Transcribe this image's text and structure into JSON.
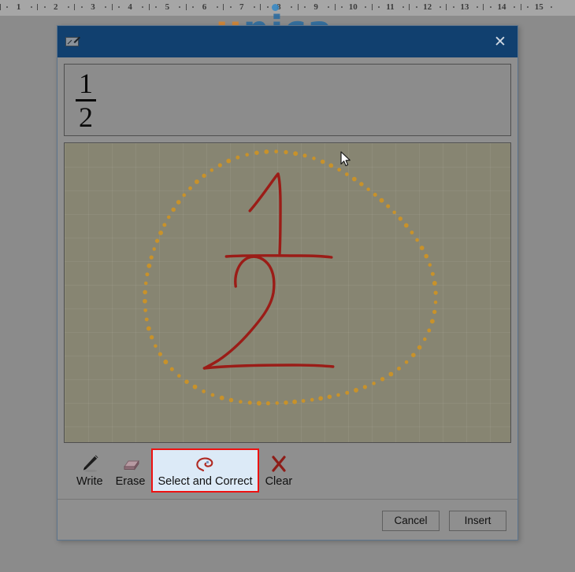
{
  "ruler": {
    "name": "word-horizontal-ruler",
    "marks": [
      "1",
      "2",
      "3",
      "4",
      "5",
      "6",
      "7",
      "8",
      "9",
      "10",
      "11",
      "12",
      "13",
      "14",
      "15"
    ]
  },
  "watermark": {
    "first_letter": "u",
    "rest": "nica",
    "color_u": "#d6842c",
    "color_rest": "#2468a0"
  },
  "dialog": {
    "titlebar": {
      "icon": "ink-equation-icon",
      "title": "",
      "close_label": "✕",
      "background": "#11406f"
    },
    "preview": {
      "name": "equation-preview",
      "numerator": "1",
      "denominator": "2",
      "expression": "1/2"
    },
    "canvas": {
      "name": "ink-writing-canvas",
      "background": "#878572",
      "ink_color": "#9b1c17",
      "lasso_color": "#c8922a",
      "grid": true,
      "strokes": [
        "handwritten-1",
        "fraction-bar",
        "handwritten-2"
      ],
      "selection": "dotted-lasso-loop"
    },
    "tools": [
      {
        "id": "write",
        "label": "Write",
        "icon": "pen-icon",
        "active": false
      },
      {
        "id": "erase",
        "label": "Erase",
        "icon": "eraser-icon",
        "active": false
      },
      {
        "id": "select",
        "label": "Select and Correct",
        "icon": "lasso-icon",
        "active": true
      },
      {
        "id": "clear",
        "label": "Clear",
        "icon": "x-mark-icon",
        "active": false
      }
    ],
    "footer": {
      "cancel_label": "Cancel",
      "insert_label": "Insert"
    }
  }
}
